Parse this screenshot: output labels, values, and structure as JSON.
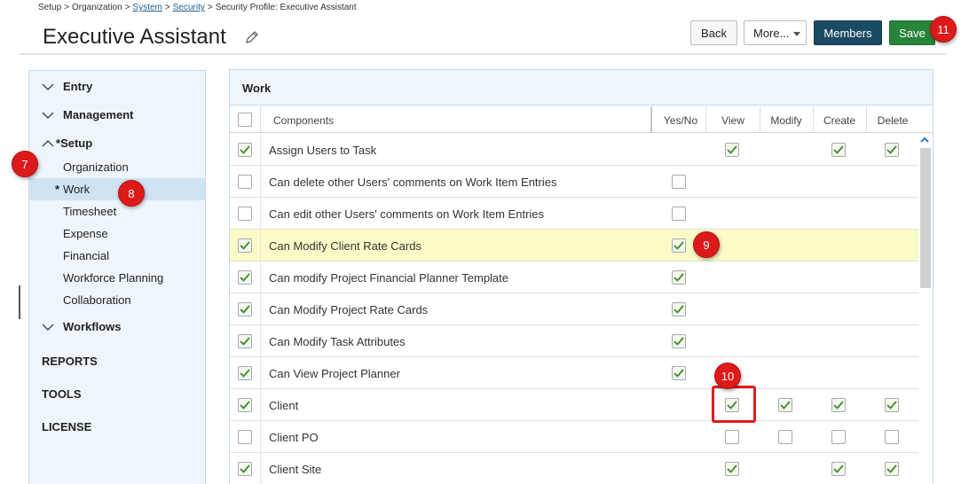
{
  "breadcrumb": {
    "items": [
      "Setup",
      "Organization",
      "System",
      "Security",
      "Security Profile: Executive Assistant"
    ],
    "separator": ">"
  },
  "page_title": "Executive Assistant",
  "header_buttons": {
    "back": "Back",
    "more": "More...",
    "members": "Members",
    "save": "Save"
  },
  "badges": [
    "7",
    "8",
    "9",
    "10",
    "11"
  ],
  "sidebar": {
    "groups": {
      "entry": "Entry",
      "management": "Management",
      "setup": "Setup",
      "workflows": "Workflows"
    },
    "modified_marker": "*",
    "setup_items": [
      "Organization",
      "Work",
      "Timesheet",
      "Expense",
      "Financial",
      "Workforce Planning",
      "Collaboration"
    ],
    "active_item": "Work",
    "sections": [
      "REPORTS",
      "TOOLS",
      "LICENSE"
    ]
  },
  "panel": {
    "title": "Work",
    "columns": [
      "Components",
      "Yes/No",
      "View",
      "Modify",
      "Create",
      "Delete"
    ],
    "rows": [
      {
        "name": "Assign Users to Task",
        "row": true,
        "yesno": null,
        "view": true,
        "modify": null,
        "create": true,
        "delete": true
      },
      {
        "name": "Can delete other Users' comments on Work Item Entries",
        "row": false,
        "yesno": false,
        "view": null,
        "modify": null,
        "create": null,
        "delete": null
      },
      {
        "name": "Can edit other Users' comments on Work Item Entries",
        "row": false,
        "yesno": false,
        "view": null,
        "modify": null,
        "create": null,
        "delete": null
      },
      {
        "name": "Can Modify Client Rate Cards",
        "row": true,
        "yesno": true,
        "view": null,
        "modify": null,
        "create": null,
        "delete": null,
        "highlight": true
      },
      {
        "name": "Can modify Project Financial Planner Template",
        "row": true,
        "yesno": true,
        "view": null,
        "modify": null,
        "create": null,
        "delete": null
      },
      {
        "name": "Can Modify Project Rate Cards",
        "row": true,
        "yesno": true,
        "view": null,
        "modify": null,
        "create": null,
        "delete": null
      },
      {
        "name": "Can Modify Task Attributes",
        "row": true,
        "yesno": true,
        "view": null,
        "modify": null,
        "create": null,
        "delete": null
      },
      {
        "name": "Can View Project Planner",
        "row": true,
        "yesno": true,
        "view": null,
        "modify": null,
        "create": null,
        "delete": null
      },
      {
        "name": "Client",
        "row": true,
        "yesno": null,
        "view": true,
        "modify": true,
        "create": true,
        "delete": true
      },
      {
        "name": "Client PO",
        "row": false,
        "yesno": null,
        "view": false,
        "modify": false,
        "create": false,
        "delete": false
      },
      {
        "name": "Client Site",
        "row": true,
        "yesno": null,
        "view": true,
        "modify": null,
        "create": true,
        "delete": true
      }
    ]
  },
  "colors": {
    "members_button": "#1b4a63",
    "save_button": "#27843a",
    "badge": "#dd1a1a",
    "check": "#3d8a2a",
    "highlight_row": "#fbfbc8",
    "sidebar_bg": "#eef5fb",
    "active_item_bg": "#cfe3f5"
  },
  "icons": {
    "edit": "pencil-icon",
    "group_collapse": "chevron-up-icon",
    "group_expand": "chevron-down-icon",
    "more_dropdown": "caret-down-icon",
    "check": "checkmark-icon",
    "scroll_up": "chevron-up-icon"
  }
}
